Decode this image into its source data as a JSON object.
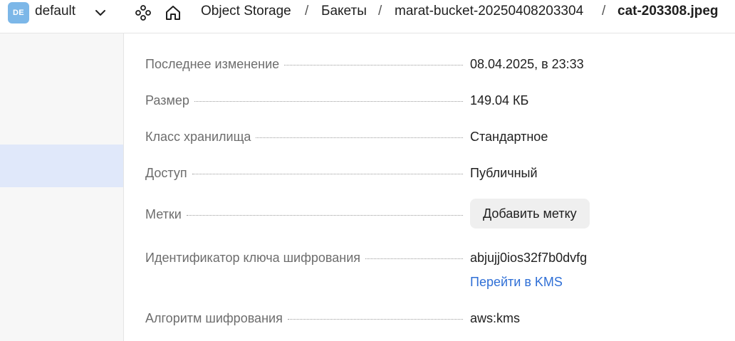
{
  "header": {
    "folder_badge": "DE",
    "folder_name": "default",
    "breadcrumbs": [
      "Object Storage",
      "Бакеты",
      "marat-bucket-20250408203304",
      "cat-203308.jpeg"
    ],
    "separator": "/"
  },
  "details": {
    "modified": {
      "label": "Последнее изменение",
      "value": "08.04.2025, в 23:33"
    },
    "size": {
      "label": "Размер",
      "value": "149.04 КБ"
    },
    "storage_class": {
      "label": "Класс хранилища",
      "value": "Стандартное"
    },
    "access": {
      "label": "Доступ",
      "value": "Публичный"
    },
    "tags": {
      "label": "Метки",
      "button": "Добавить метку"
    },
    "encryption_key": {
      "label": "Идентификатор ключа шифрования",
      "value": "abjujj0ios32f7b0dvfg",
      "link": "Перейти в KMS"
    },
    "encryption_algorithm": {
      "label": "Алгоритм шифрования",
      "value": "aws:kms"
    }
  },
  "colors": {
    "link": "#2f6fd6",
    "avatar": "#7cb7e8",
    "sidebar_active": "#e0e8fa"
  },
  "icons": [
    "chevron-down-icon",
    "services-icon",
    "home-icon"
  ]
}
